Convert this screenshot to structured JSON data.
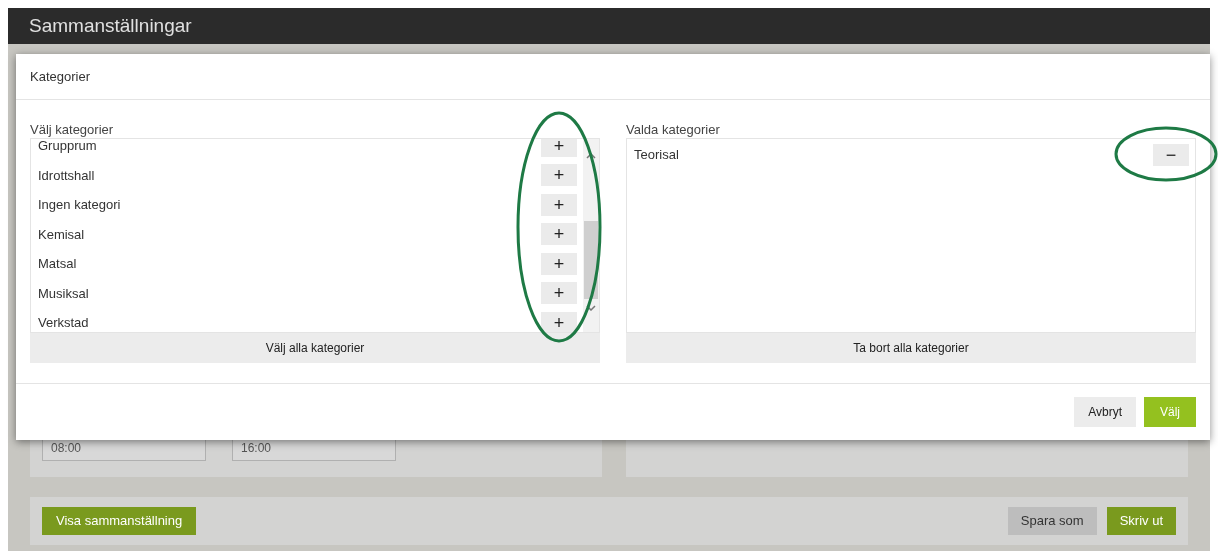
{
  "page": {
    "title": "Sammanställningar"
  },
  "background": {
    "start_time": "08:00",
    "end_time": "16:00",
    "show_button": "Visa sammanställning",
    "save_as_button": "Spara som",
    "print_button": "Skriv ut"
  },
  "dialog": {
    "title": "Kategorier",
    "available": {
      "label": "Välj kategorier",
      "items": [
        {
          "name": "Grupprum",
          "action": "+"
        },
        {
          "name": "Idrottshall",
          "action": "+"
        },
        {
          "name": "Ingen kategori",
          "action": "+"
        },
        {
          "name": "Kemisal",
          "action": "+"
        },
        {
          "name": "Matsal",
          "action": "+"
        },
        {
          "name": "Musiksal",
          "action": "+"
        },
        {
          "name": "Verkstad",
          "action": "+"
        }
      ],
      "all_button": "Välj alla kategorier"
    },
    "selected": {
      "label": "Valda kategorier",
      "items": [
        {
          "name": "Teorisal",
          "action": "−"
        }
      ],
      "all_button": "Ta bort alla kategorier"
    },
    "cancel_button": "Avbryt",
    "ok_button": "Välj"
  }
}
